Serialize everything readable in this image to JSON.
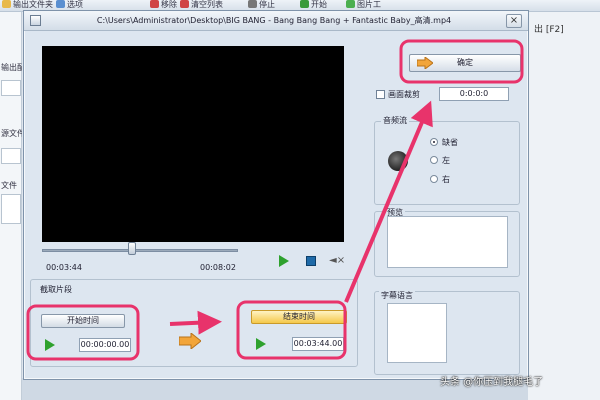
{
  "background_app": {
    "toolbar": [
      {
        "label": "输出文件夹",
        "icon": "folder-icon"
      },
      {
        "label": "选项",
        "icon": "options-icon"
      },
      {
        "label": "移除",
        "icon": "remove-icon"
      },
      {
        "label": "清空列表",
        "icon": "clear-list-icon"
      },
      {
        "label": "停止",
        "icon": "stop-icon"
      },
      {
        "label": "开始",
        "icon": "start-icon"
      },
      {
        "label": "图片工",
        "icon": "picture-tool-icon"
      }
    ],
    "left_labels": [
      "输出配",
      "源文件",
      "文件"
    ],
    "right_label": "出 [F2]"
  },
  "dialog": {
    "title": "C:\\Users\\Administrator\\Desktop\\BIG BANG - Bang Bang Bang + Fantastic Baby_高清.mp4",
    "close_label": "×"
  },
  "player": {
    "current_time": "00:03:44",
    "total_time": "00:08:02",
    "progress_fraction": 0.46
  },
  "trim": {
    "legend": "截取片段",
    "start_button": "开始时间",
    "start_time": "00:00:00.00",
    "end_button": "结束时间",
    "end_time": "00:03:44.00"
  },
  "right_panel": {
    "ok_button": "确定",
    "crop_label": "画面裁剪",
    "crop_value": "0:0:0:0",
    "audio_legend": "音频流",
    "audio_options": [
      "缺省",
      "左",
      "右"
    ],
    "audio_selected": "缺省",
    "preview_legend": "预览",
    "subtitle_legend": "字幕语言"
  },
  "annotation": {
    "highlight_color": "#e8336b",
    "watermark": "头条 @你压到我腿毛了"
  }
}
